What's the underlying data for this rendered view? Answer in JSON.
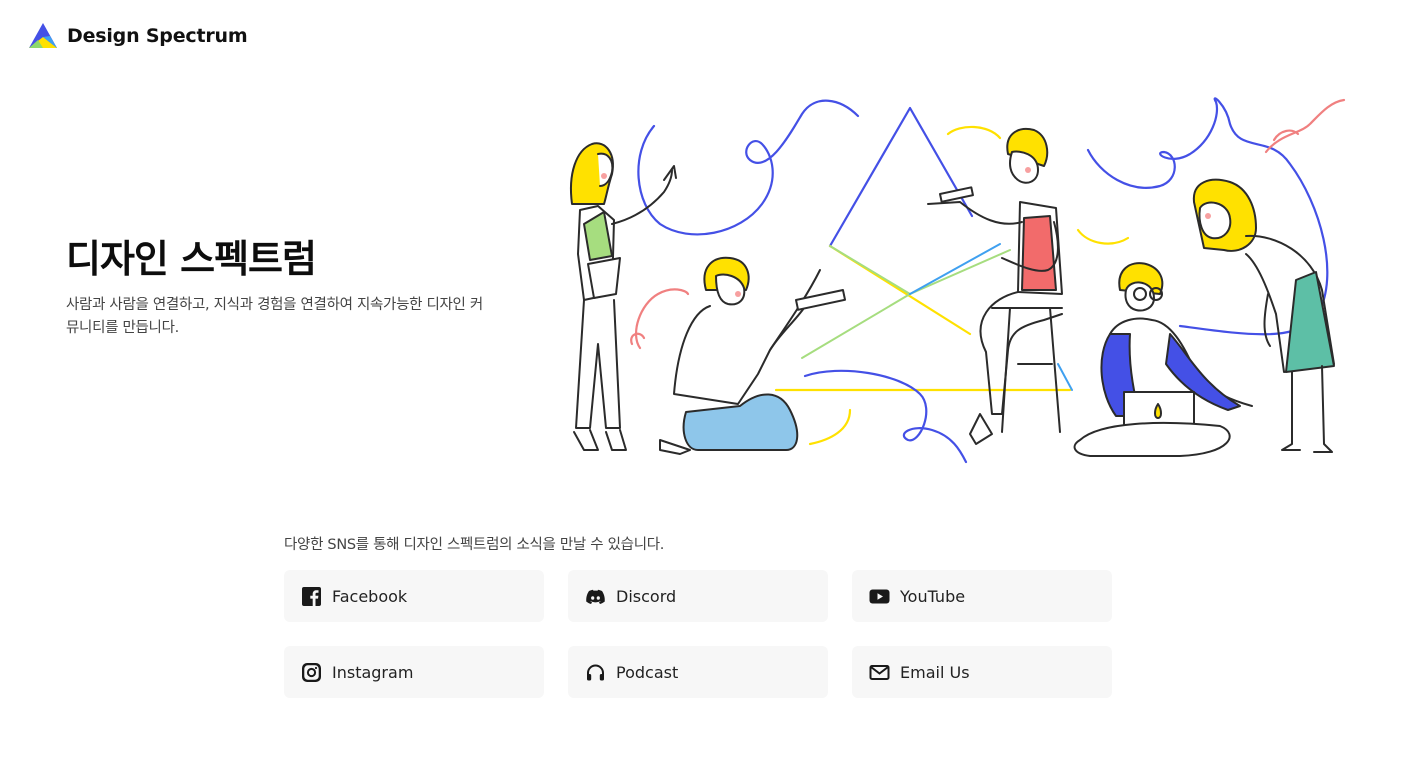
{
  "header": {
    "logo_text": "Design Spectrum",
    "logo_icon": "triangle-spectrum-logo"
  },
  "hero": {
    "title": "디자인 스펙트럼",
    "description": "사람과 사람을 연결하고, 지식과 경험을 연결하여 지속가능한 디자인 커뮤니티를 만듭니다."
  },
  "sns": {
    "intro": "다양한 SNS를 통해 디자인 스펙트럼의 소식을 만날 수 있습니다.",
    "links": [
      {
        "label": "Facebook",
        "icon": "facebook-icon"
      },
      {
        "label": "Discord",
        "icon": "discord-icon"
      },
      {
        "label": "YouTube",
        "icon": "youtube-icon"
      },
      {
        "label": "Instagram",
        "icon": "instagram-icon"
      },
      {
        "label": "Podcast",
        "icon": "headphones-icon"
      },
      {
        "label": "Email Us",
        "icon": "mail-icon"
      }
    ]
  },
  "colors": {
    "blue": "#4450e6",
    "yellow": "#ffe100",
    "green": "#a6dd7f",
    "pink": "#f08080",
    "teal": "#5dbfa6",
    "light_blue": "#8ec6ea",
    "card_bg": "#f7f7f7"
  }
}
